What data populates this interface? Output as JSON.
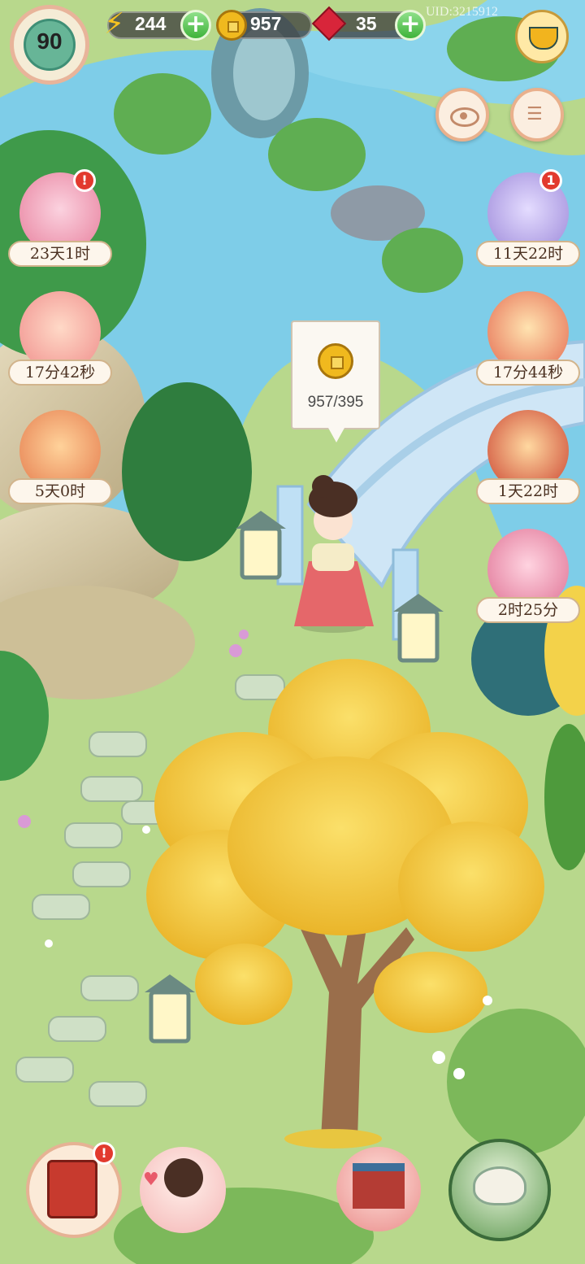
{
  "player": {
    "level": "90",
    "uid": "UID:3215912"
  },
  "resources": {
    "energy": "244",
    "coins": "957",
    "gems": "35"
  },
  "events_left": [
    {
      "timer": "23天1时",
      "badge": "!"
    },
    {
      "timer": "17分42秒"
    },
    {
      "timer": "5天0时"
    }
  ],
  "events_right": [
    {
      "timer": "11天22时",
      "badge": "1"
    },
    {
      "timer": "17分44秒"
    },
    {
      "timer": "1天22时"
    },
    {
      "timer": "2时25分"
    }
  ],
  "coin_bubble": {
    "value": "957/395"
  },
  "bottom_menu": {
    "badge": "!"
  },
  "colors": {
    "water": "#7ecde8",
    "grass": "#b6d68a",
    "ginkgo": "#f5cf3a",
    "badge": "#e23a2e"
  }
}
